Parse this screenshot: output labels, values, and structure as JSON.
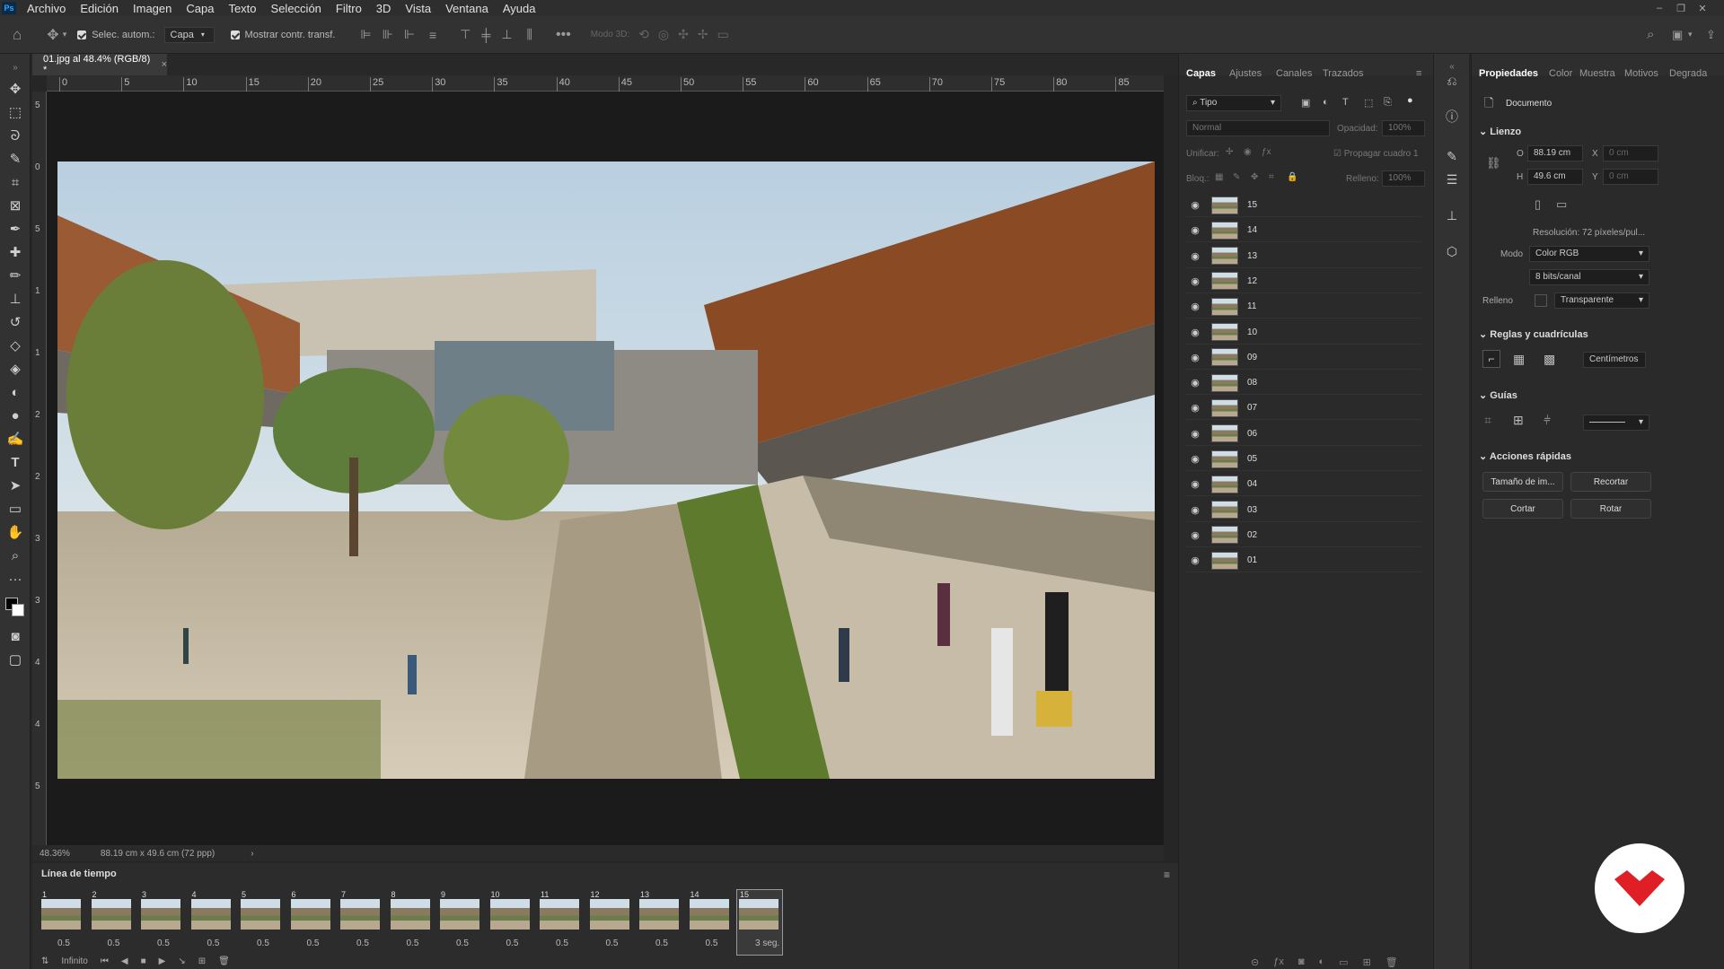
{
  "app": {
    "logo": "Ps"
  },
  "menu": [
    "Archivo",
    "Edición",
    "Imagen",
    "Capa",
    "Texto",
    "Selección",
    "Filtro",
    "3D",
    "Vista",
    "Ventana",
    "Ayuda"
  ],
  "options": {
    "auto_select_label": "Selec. autom.:",
    "auto_select_target": "Capa",
    "show_transform_label": "Mostrar contr. transf.",
    "mode3d_label": "Modo 3D:"
  },
  "document": {
    "tab_title": "01.jpg al 48.4% (RGB/8) *",
    "close": "×"
  },
  "ruler": {
    "h_ticks": [
      "0",
      "5",
      "10",
      "15",
      "20",
      "25",
      "30",
      "35",
      "40",
      "45",
      "50",
      "55",
      "60",
      "65",
      "70",
      "75",
      "80",
      "85"
    ],
    "v_ticks": [
      "5",
      "0",
      "5",
      "1",
      "1",
      "2",
      "2",
      "3",
      "3",
      "4",
      "4",
      "5"
    ]
  },
  "status": {
    "zoom": "48.36%",
    "size": "88.19 cm x 49.6 cm (72 ppp)",
    "arrow": "›"
  },
  "timeline": {
    "title": "Línea de tiempo",
    "frames": [
      {
        "num": "1",
        "delay": "0.5"
      },
      {
        "num": "2",
        "delay": "0.5"
      },
      {
        "num": "3",
        "delay": "0.5"
      },
      {
        "num": "4",
        "delay": "0.5"
      },
      {
        "num": "5",
        "delay": "0.5"
      },
      {
        "num": "6",
        "delay": "0.5"
      },
      {
        "num": "7",
        "delay": "0.5"
      },
      {
        "num": "8",
        "delay": "0.5"
      },
      {
        "num": "9",
        "delay": "0.5"
      },
      {
        "num": "10",
        "delay": "0.5"
      },
      {
        "num": "11",
        "delay": "0.5"
      },
      {
        "num": "12",
        "delay": "0.5"
      },
      {
        "num": "13",
        "delay": "0.5"
      },
      {
        "num": "14",
        "delay": "0.5"
      },
      {
        "num": "15",
        "delay": "3 seg."
      }
    ],
    "loop": "Infinito"
  },
  "layers_panel": {
    "tabs": [
      "Capas",
      "Ajustes",
      "Canales",
      "Trazados"
    ],
    "filter": "Tipo",
    "blend": "Normal",
    "opacity_label": "Opacidad:",
    "opacity": "100%",
    "unify_label": "Unificar:",
    "propagate_label": "Propagar cuadro 1",
    "lock_label": "Bloq.:",
    "fill_label": "Relleno:",
    "fill": "100%",
    "layers": [
      "15",
      "14",
      "13",
      "12",
      "11",
      "10",
      "09",
      "08",
      "07",
      "06",
      "05",
      "04",
      "03",
      "02",
      "01"
    ]
  },
  "props_panel": {
    "tabs": [
      "Propiedades",
      "Color",
      "Muestra",
      "Motivos",
      "Degrada"
    ],
    "doc_label": "Documento",
    "canvas_section": "Lienzo",
    "w_label": "O",
    "w_value": "88.19 cm",
    "h_label": "H",
    "h_value": "49.6 cm",
    "x_label": "X",
    "x_value": "0 cm",
    "y_label": "Y",
    "y_value": "0 cm",
    "resolution": "Resolución: 72 píxeles/pul...",
    "mode_label": "Modo",
    "mode_value": "Color RGB",
    "bits_value": "8 bits/canal",
    "fill_label": "Relleno",
    "fill_value": "Transparente",
    "rulers_section": "Reglas y cuadrículas",
    "units": "Centímetros",
    "guides_section": "Guías",
    "quick_section": "Acciones rápidas",
    "btn_image_size": "Tamaño de im...",
    "btn_crop": "Recortar",
    "btn_cut": "Cortar",
    "btn_rotate": "Rotar"
  }
}
